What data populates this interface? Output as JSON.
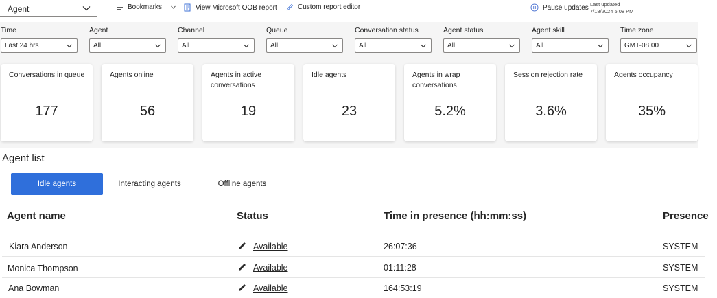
{
  "toolbar": {
    "view_selector": "Agent",
    "bookmarks": "Bookmarks",
    "oob_report": "View Microsoft OOB report",
    "custom_editor": "Custom report editor",
    "pause_updates": "Pause updates",
    "last_updated_label": "Last updated",
    "last_updated_value": "7/18/2024 5:08 PM"
  },
  "filters": [
    {
      "label": "Time",
      "value": "Last 24 hrs"
    },
    {
      "label": "Agent",
      "value": "All"
    },
    {
      "label": "Channel",
      "value": "All"
    },
    {
      "label": "Queue",
      "value": "All"
    },
    {
      "label": "Conversation status",
      "value": "All"
    },
    {
      "label": "Agent status",
      "value": "All"
    },
    {
      "label": "Agent skill",
      "value": "All"
    },
    {
      "label": "Time zone",
      "value": "GMT-08:00"
    }
  ],
  "kpis": [
    {
      "title": "Conversations in queue",
      "value": "177"
    },
    {
      "title": "Agents online",
      "value": "56"
    },
    {
      "title": "Agents in active conversations",
      "value": "19"
    },
    {
      "title": "Idle agents",
      "value": "23"
    },
    {
      "title": "Agents in wrap conversations",
      "value": "5.2%"
    },
    {
      "title": "Session rejection rate",
      "value": "3.6%"
    },
    {
      "title": "Agents occupancy",
      "value": "35%"
    }
  ],
  "agent_list": {
    "title": "Agent list",
    "tabs": [
      "Idle agents",
      "Interacting agents",
      "Offline agents"
    ],
    "columns": [
      "Agent name",
      "Status",
      "Time in presence (hh:mm:ss)",
      "Presence"
    ],
    "rows": [
      {
        "name": "Kiara Anderson",
        "status": "Available",
        "time": "26:07:36",
        "presence": "SYSTEM"
      },
      {
        "name": "Monica Thompson",
        "status": "Available",
        "time": "01:11:28",
        "presence": "SYSTEM"
      },
      {
        "name": "Ana Bowman",
        "status": "Available",
        "time": "164:53:19",
        "presence": "SYSTEM"
      }
    ]
  },
  "colors": {
    "accent": "#2f6fdb",
    "filter_bg": "#f5f5f5",
    "pause_icon": "#5b7fd6"
  }
}
